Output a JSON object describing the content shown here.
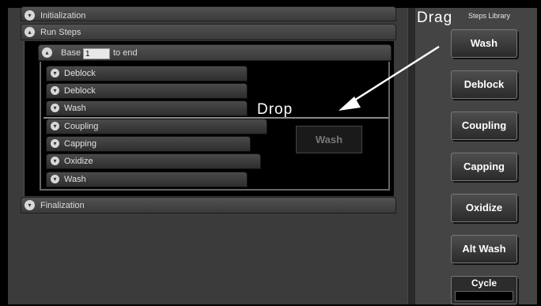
{
  "sections": {
    "initialization": "Initialization",
    "run_steps": "Run Steps",
    "finalization": "Finalization"
  },
  "base_row": {
    "prefix": "Base",
    "value": "1",
    "suffix": "to end"
  },
  "steps": [
    "Deblock",
    "Deblock",
    "Wash",
    "Coupling",
    "Capping",
    "Oxidize",
    "Wash"
  ],
  "annotations": {
    "drag": "Drag",
    "drop": "Drop"
  },
  "drop_ghost": "Wash",
  "library": {
    "title": "Steps Library",
    "buttons": [
      "Wash",
      "Deblock",
      "Coupling",
      "Capping",
      "Oxidize",
      "Alt Wash"
    ],
    "cycle": "Cycle"
  },
  "icons": {
    "collapsed": "chevron-down-icon",
    "expanded": "chevron-up-icon",
    "arrow": "arrow-icon"
  }
}
